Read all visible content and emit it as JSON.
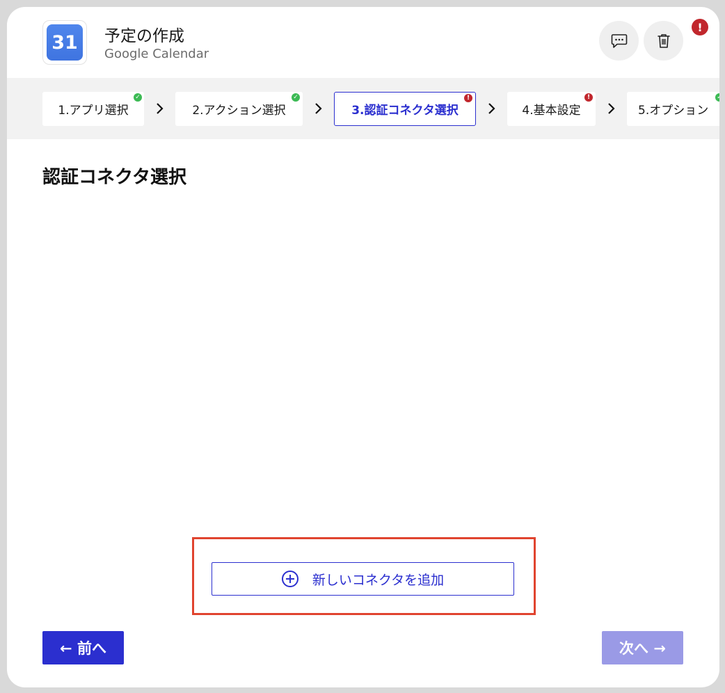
{
  "header": {
    "app_icon_text": "31",
    "title": "予定の作成",
    "subtitle": "Google Calendar",
    "alert_badge": "!"
  },
  "steps": [
    {
      "label": "1.アプリ選択",
      "status": "ok"
    },
    {
      "label": "2.アクション選択",
      "status": "ok"
    },
    {
      "label": "3.認証コネクタ選択",
      "status": "error",
      "active": true
    },
    {
      "label": "4.基本設定",
      "status": "error"
    },
    {
      "label": "5.オプション",
      "status": "ok"
    }
  ],
  "main": {
    "section_title": "認証コネクタ選択",
    "add_connector_label": "新しいコネクタを追加"
  },
  "footer": {
    "prev_label": "← 前へ",
    "next_label": "次へ →"
  },
  "colors": {
    "accent": "#2b2fcf",
    "accent_disabled": "#9a9ae6",
    "ok": "#3cba54",
    "error": "#c1272d",
    "highlight": "#e0442f"
  },
  "icons": {
    "comment": "comment-icon",
    "delete": "trash-icon",
    "plus": "plus-circle-icon",
    "chevron": "chevron-right-icon"
  }
}
